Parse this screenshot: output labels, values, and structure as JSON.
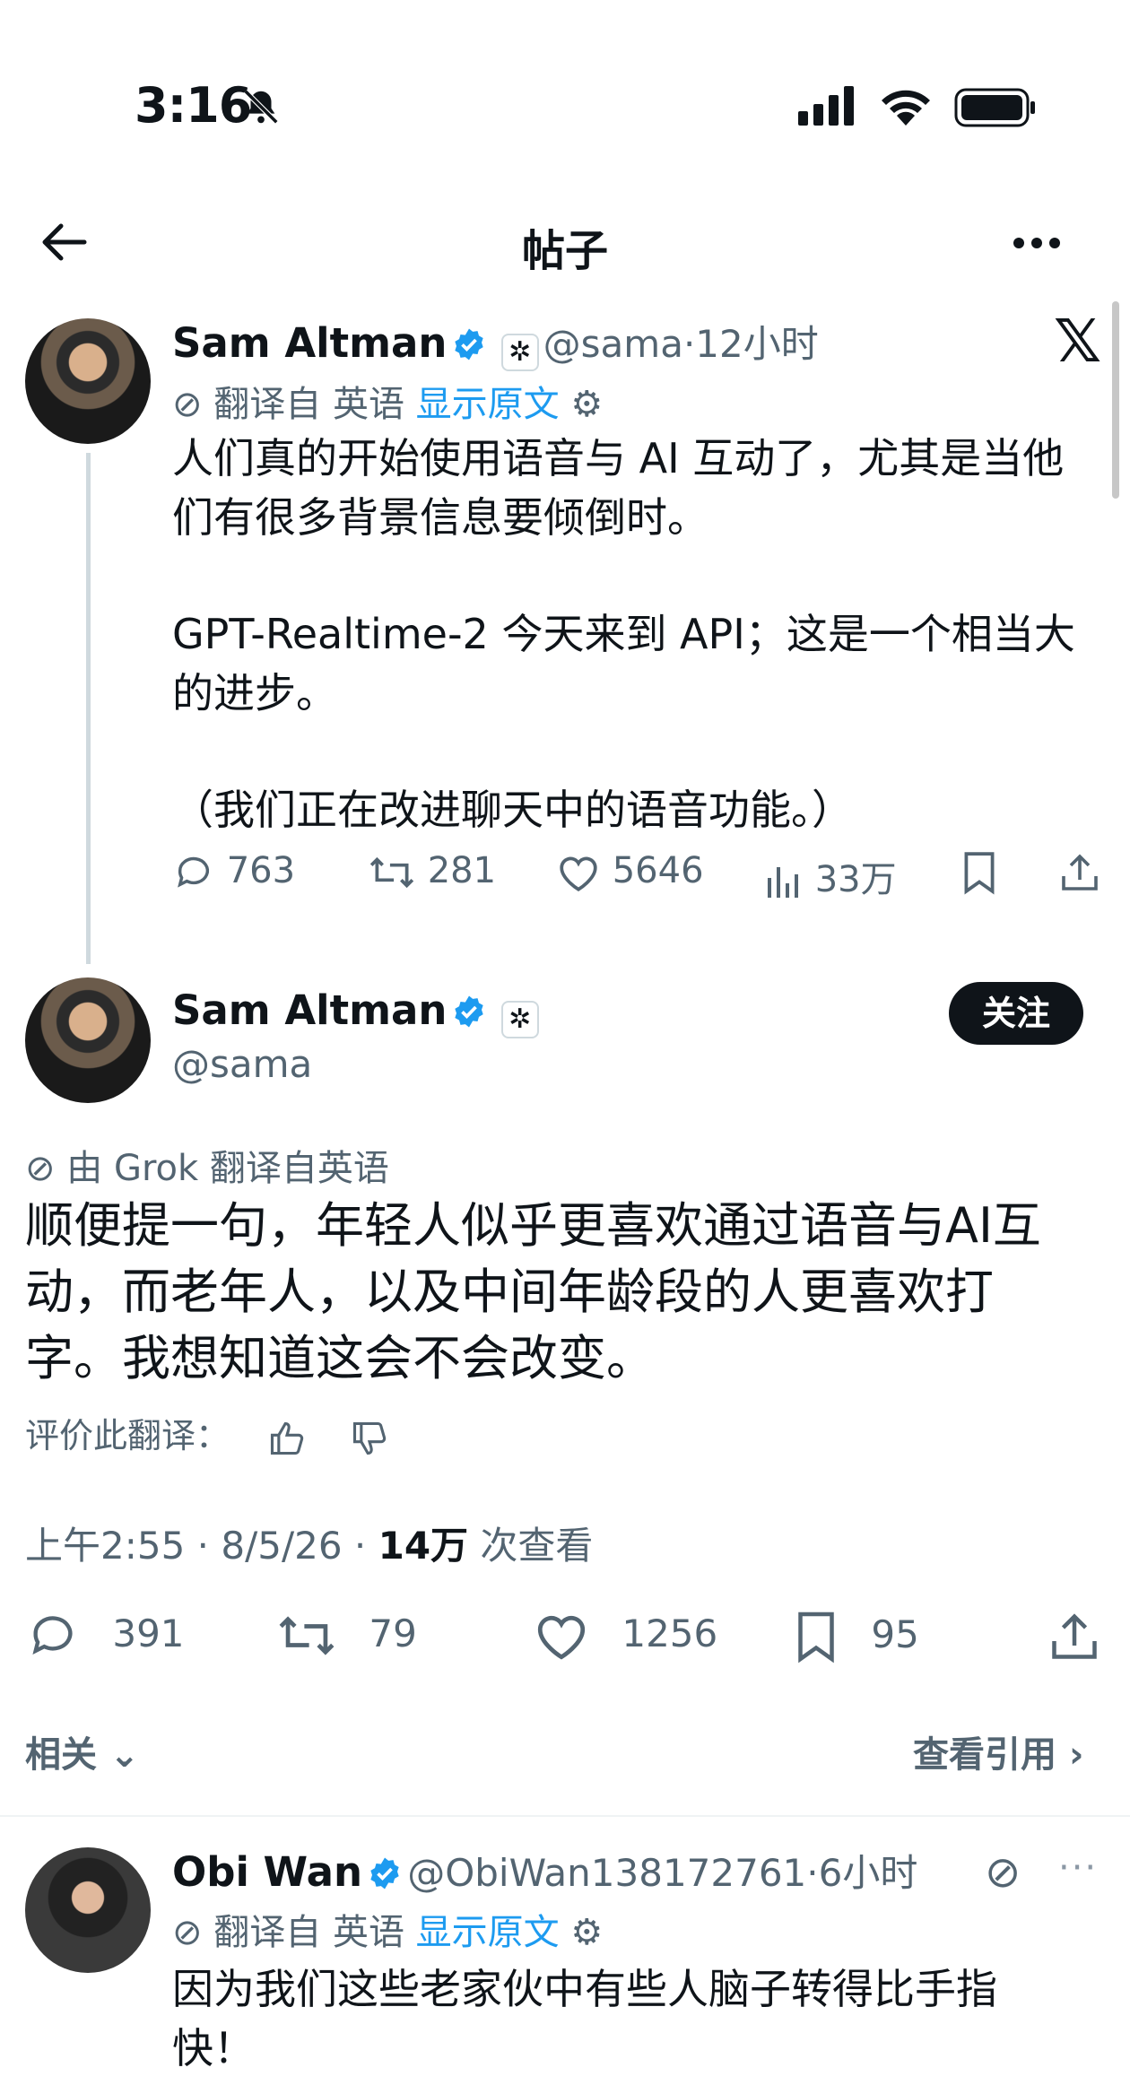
{
  "status_bar": {
    "time": "3:16"
  },
  "header": {
    "title": "帖子"
  },
  "tweet1": {
    "name": "Sam Altman",
    "handle": "@sama",
    "time": "·12小时",
    "translated_from": "翻译自 英语",
    "show_original": "显示原文",
    "lines": [
      "人们真的开始使用语音与 AI 互动了，尤其是当他",
      "们有很多背景信息要倾倒时。",
      "GPT-Realtime-2 今天来到 API；这是一个相当大",
      "的进步。",
      "（我们正在改进聊天中的语音功能。）"
    ],
    "replies": "763",
    "retweets": "281",
    "likes": "5646",
    "views": "33万"
  },
  "tweet2": {
    "name": "Sam Altman",
    "handle": "@sama",
    "follow": "关注",
    "grok_translation": "由 Grok 翻译自英语",
    "lines": [
      "顺便提一句，年轻人似乎更喜欢通过语音与AI互",
      "动，而老年人，以及中间年龄段的人更喜欢打",
      "字。我想知道这会不会改变。"
    ],
    "rate_label": "评价此翻译：",
    "timestamp": "上午2:55 · 8/5/26 · ",
    "views_count": "14万",
    "views_label": " 次查看",
    "replies": "391",
    "retweets": "79",
    "likes": "1256",
    "bookmarks": "95"
  },
  "related_label": "相关",
  "view_quotes": "查看引用",
  "tweet3": {
    "name": "Obi Wan",
    "handle": "@ObiWan138172761",
    "time": "·6小时",
    "translated_from": "翻译自 英语",
    "show_original": "显示原文",
    "lines": [
      "因为我们这些老家伙中有些人脑子转得比手指",
      "快！"
    ]
  }
}
